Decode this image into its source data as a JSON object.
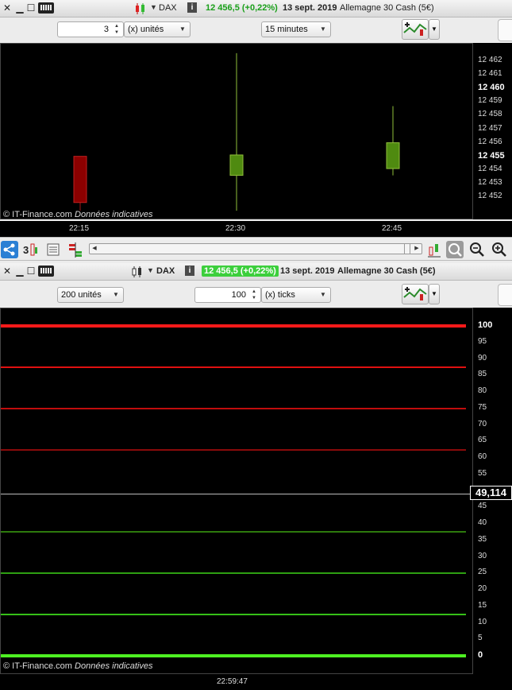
{
  "top_window": {
    "symbol": "DAX",
    "price": "12 456,5 (+0,22%)",
    "date": "13 sept. 2019",
    "description": "Allemagne 30 Cash (5€)",
    "units_value": "3",
    "units_label": "(x) unités",
    "timeframe": "15 minutes",
    "credit_source": "© IT-Finance.com",
    "credit_note": "Données indicatives"
  },
  "bottom_window": {
    "symbol": "DAX",
    "price": "12 456,5 (+0,22%)",
    "date": "13 sept. 2019",
    "description": "Allemagne 30 Cash (5€)",
    "units_label": "200 unités",
    "ticks_value": "100",
    "ticks_label": "(x) ticks",
    "credit_source": "© IT-Finance.com",
    "credit_note": "Données indicatives",
    "time_label": "22:59:47",
    "current_value_label": "49,114"
  },
  "icons": {
    "close": "close-icon",
    "minimize": "minimize-icon",
    "maximize": "maximize-icon",
    "keyboard": "keyboard-icon",
    "candles": "candlestick-icon",
    "info": "info-icon",
    "share": "share-icon",
    "zoom_out": "zoom-out-icon",
    "zoom_in": "zoom-in-icon"
  },
  "colors": {
    "bull": "#4f8a10",
    "bear": "#8b0000",
    "price_up": "#1aa01a",
    "price_highlight": "#3ccf3c"
  },
  "chart_data": [
    {
      "type": "candlestick",
      "x": [
        "22:15",
        "22:30",
        "22:45"
      ],
      "candles": [
        {
          "time": "22:15",
          "open": 12455.0,
          "close": 12451.6,
          "high": 12455.0,
          "low": 12451.0
        },
        {
          "time": "22:30",
          "open": 12453.6,
          "close": 12455.1,
          "high": 12462.6,
          "low": 12451.0
        },
        {
          "time": "22:45",
          "open": 12454.1,
          "close": 12456.0,
          "high": 12458.7,
          "low": 12453.6
        }
      ],
      "yticks": [
        "12 462",
        "12 461",
        "12 460",
        "12 459",
        "12 458",
        "12 457",
        "12 456",
        "12 455",
        "12 454",
        "12 453",
        "12 452"
      ],
      "bold_ticks": [
        "12 460",
        "12 455"
      ],
      "ylim": [
        12451.0,
        12463.0
      ]
    },
    {
      "type": "line",
      "levels": [
        {
          "value": 100,
          "color": "#ff1a1a"
        },
        {
          "value": 87.5,
          "color": "#e01010"
        },
        {
          "value": 75,
          "color": "#c00d0d"
        },
        {
          "value": 62.5,
          "color": "#8a0a0a"
        },
        {
          "value": 37.5,
          "color": "#2d7a0d"
        },
        {
          "value": 25,
          "color": "#2ea012"
        },
        {
          "value": 12.5,
          "color": "#36c018"
        },
        {
          "value": 0,
          "color": "#4ef022"
        }
      ],
      "current_value": 49.114,
      "yticks": [
        "100",
        "95",
        "90",
        "85",
        "80",
        "75",
        "70",
        "65",
        "60",
        "55",
        "45",
        "40",
        "35",
        "30",
        "25",
        "20",
        "15",
        "10",
        "5",
        "0"
      ],
      "ylim": [
        0,
        100
      ]
    }
  ]
}
